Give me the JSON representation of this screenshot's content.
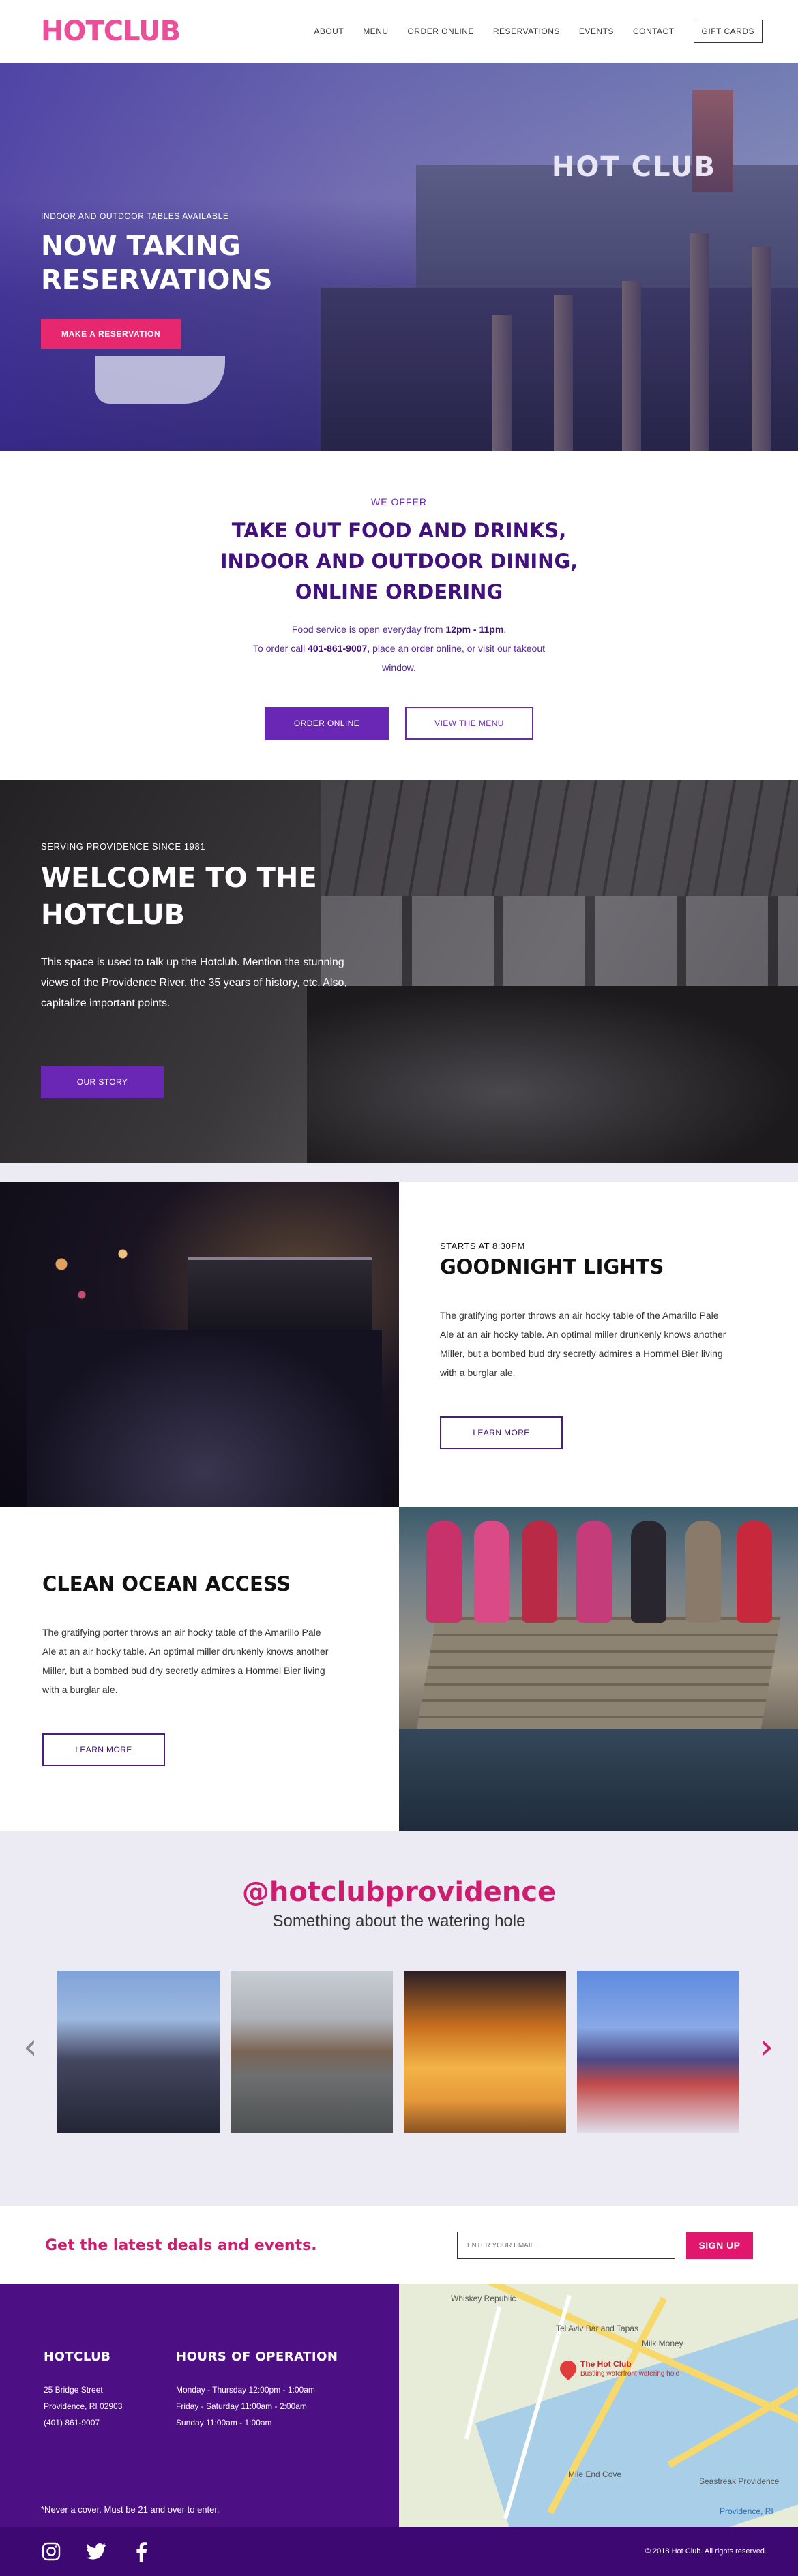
{
  "header": {
    "logo": "HOTCLUB",
    "nav": [
      "ABOUT",
      "MENU",
      "ORDER ONLINE",
      "RESERVATIONS",
      "EVENTS",
      "CONTACT"
    ],
    "gift_cards": "GIFT CARDS"
  },
  "hero": {
    "kicker": "INDOOR AND OUTDOOR TABLES AVAILABLE",
    "title": "NOW TAKING RESERVATIONS",
    "button": "MAKE A RESERVATION",
    "sign_text": "HOT CLUB"
  },
  "offer": {
    "kicker": "WE OFFER",
    "title": "TAKE OUT FOOD AND DRINKS, INDOOR AND OUTDOOR DINING, ONLINE ORDERING",
    "line1_pre": "Food service is open everyday from ",
    "line1_bold": "12pm - 11pm",
    "line1_post": ".",
    "line2_pre": "To order call ",
    "line2_bold": "401-861-9007",
    "line2_post": ", place an order online, or visit our takeout window.",
    "order_button": "ORDER ONLINE",
    "menu_button": "VIEW THE MENU"
  },
  "welcome": {
    "kicker": "SERVING PROVIDENCE SINCE 1981",
    "title": "WELCOME TO THE HOTCLUB",
    "text": "This space is used to talk up the Hotclub. Mention the stunning views of the Providence River, the 35 years of history, etc. Also, capitalize important points.",
    "button": "OUR STORY"
  },
  "features": [
    {
      "kicker": "STARTS AT 8:30PM",
      "title": "GOODNIGHT LIGHTS",
      "text": "The gratifying porter throws an air hocky table of the Amarillo Pale Ale at an air hocky table. An optimal miller drunkenly knows another Miller, but a bombed bud dry secretly admires a Hommel Bier living with a burglar ale.",
      "button": "LEARN MORE"
    },
    {
      "title": "CLEAN OCEAN ACCESS",
      "text": "The gratifying porter throws an air hocky table of the Amarillo Pale Ale at an air hocky table. An optimal miller drunkenly knows another Miller, but a bombed bud dry secretly admires a Hommel Bier living with a burglar ale.",
      "button": "LEARN MORE"
    }
  ],
  "instagram": {
    "handle": "@hotclubprovidence",
    "subtitle": "Something about the watering hole"
  },
  "newsletter": {
    "title": "Get the latest deals and events.",
    "placeholder": "ENTER YOUR EMAIL...",
    "button": "SIGN UP"
  },
  "footer": {
    "col1_title": "HOTCLUB",
    "address": [
      "25 Bridge Street",
      "Providence, RI 02903",
      "(401) 861-9007"
    ],
    "col2_title": "HOURS OF OPERATION",
    "hours": [
      "Monday - Thursday 12:00pm - 1:00am",
      "Friday - Saturday 11:00am - 2:00am",
      "Sunday 11:00am - 1:00am"
    ],
    "note": "*Never a cover. Must be 21 and over to enter.",
    "copyright": "© 2018 Hot Club. All rights reserved."
  },
  "map": {
    "labels": [
      "Whiskey Republic",
      "Tel Aviv Bar and Tapas",
      "Milk Money",
      "The Hot Club",
      "Bustling waterfront watering hole",
      "Mile End Cove",
      "Seastreak Providence",
      "Providence, RI"
    ]
  },
  "icons": {
    "social": [
      "instagram-icon",
      "twitter-icon",
      "facebook-icon"
    ],
    "carousel": [
      "chevron-left-icon",
      "chevron-right-icon"
    ],
    "map": "map-pin-icon"
  },
  "colors": {
    "brand_pink": "#ec4f9a",
    "accent_pink": "#e8286e",
    "brand_purple": "#6a27b5",
    "deep_purple": "#4c0f84"
  }
}
